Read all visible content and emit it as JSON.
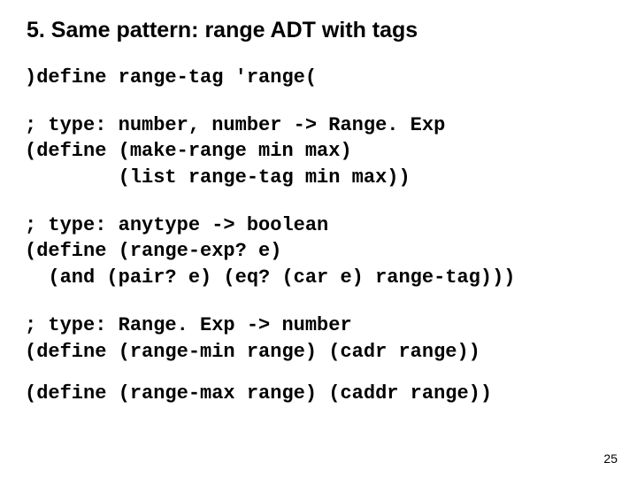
{
  "title": "5. Same pattern: range ADT with tags",
  "code1": ")define range-tag 'range(",
  "code2": "; type: number, number -> Range. Exp\n(define (make-range min max)\n        (list range-tag min max))",
  "code3": "; type: anytype -> boolean\n(define (range-exp? e)\n  (and (pair? e) (eq? (car e) range-tag)))",
  "code4": "; type: Range. Exp -> number\n(define (range-min range) (cadr range))",
  "code5": "(define (range-max range) (caddr range))",
  "pageNumber": "25"
}
